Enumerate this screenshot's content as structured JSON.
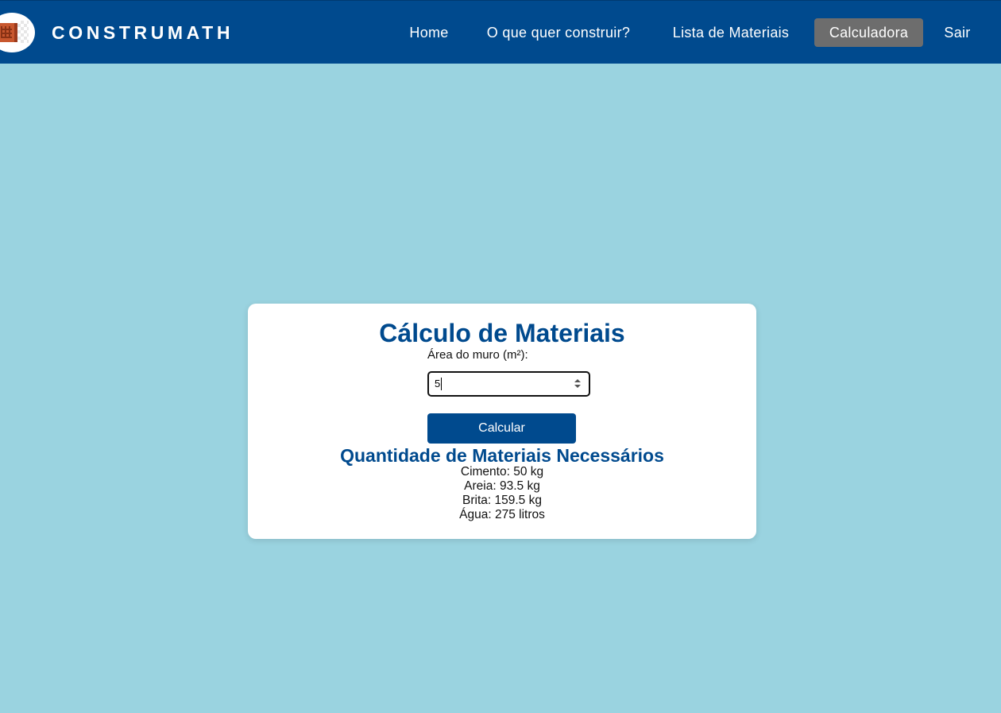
{
  "header": {
    "brand": "CONSTRUMATH",
    "logo_icon": "brick-icon",
    "nav": [
      {
        "label": "Home"
      },
      {
        "label": "O que quer construir?"
      },
      {
        "label": "Lista de Materiais"
      },
      {
        "label": "Calculadora",
        "active": true
      },
      {
        "label": "Sair"
      }
    ]
  },
  "calculator": {
    "title": "Cálculo de Materiais",
    "area_label": "Área do muro (m²):",
    "area_value": "5",
    "submit_label": "Calcular"
  },
  "results": {
    "title": "Quantidade de Materiais Necessários",
    "lines": [
      "Cimento: 50 kg",
      "Areia: 93.5 kg",
      "Brita: 159.5 kg",
      "Água: 275 litros"
    ]
  },
  "colors": {
    "primary": "#004a8e",
    "background": "#9ad3e0",
    "active_nav": "#6d6d6d",
    "card": "#ffffff"
  }
}
